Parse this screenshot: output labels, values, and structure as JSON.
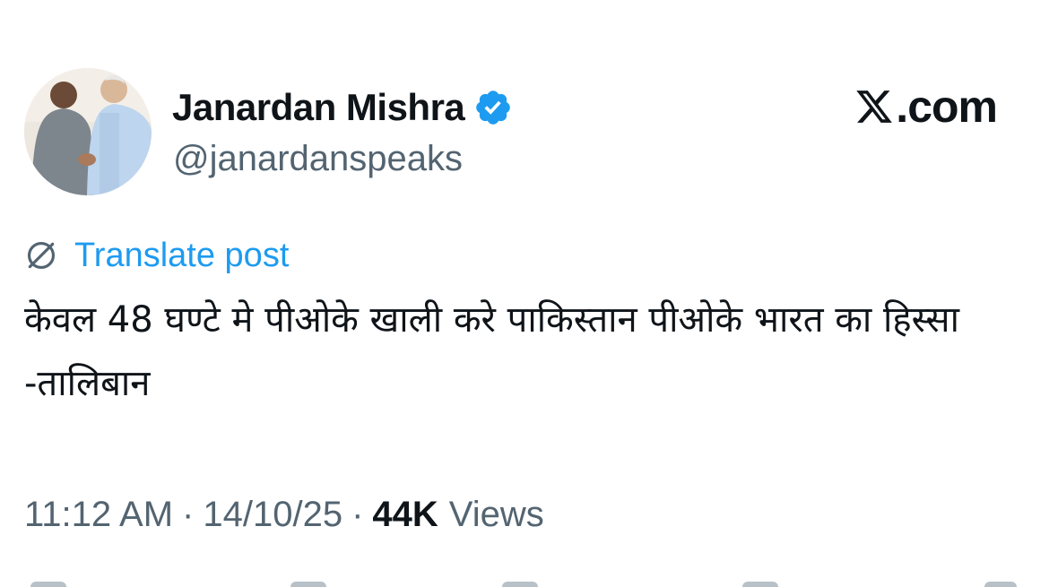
{
  "author": {
    "display_name": "Janardan Mishra",
    "handle": "@janardanspeaks",
    "verified": true
  },
  "brand": {
    "label": ".com"
  },
  "translate": {
    "label": "Translate post"
  },
  "post": {
    "text": "केवल 48 घण्टे मे पीओके खाली करे पाकिस्तान पीओके भारत का हिस्सा -तालिबान"
  },
  "meta": {
    "time": "11:12 AM",
    "separator": "·",
    "date": "14/10/25",
    "views_count": "44K",
    "views_label": "Views"
  },
  "colors": {
    "accent": "#1d9bf0",
    "text_primary": "#0f1419",
    "text_secondary": "#536471"
  },
  "icons": {
    "verified": "verified-badge-icon",
    "brand": "x-logo-icon",
    "translate": "globe-slash-icon"
  }
}
